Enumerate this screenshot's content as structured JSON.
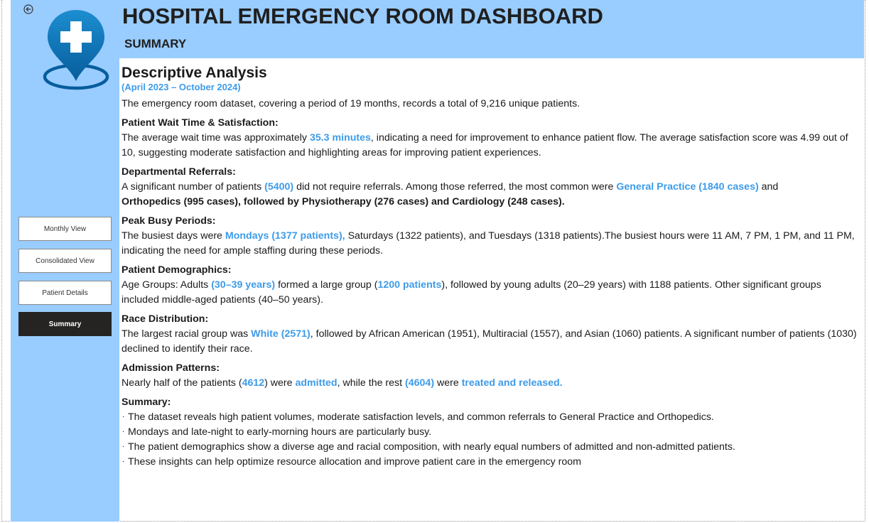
{
  "header": {
    "title": "HOSPITAL EMERGENCY ROOM DASHBOARD",
    "subtitle": "SUMMARY"
  },
  "nav": {
    "back_icon": "back-arrow-circle-icon",
    "logo_icon": "hospital-location-pin-icon",
    "items": [
      {
        "label": "Monthly View"
      },
      {
        "label": "Consolidated View"
      },
      {
        "label": "Patient Details"
      },
      {
        "label": "Summary",
        "active": true
      }
    ]
  },
  "colors": {
    "panel": "#99ccff",
    "highlight": "#3d9be9",
    "active_button": "#252423",
    "logo": "#0a6fb0"
  },
  "analysis": {
    "title": "Descriptive Analysis",
    "date_range": "(April 2023 – October 2024)",
    "intro": "The emergency room dataset, covering a period of 19 months, records a total of 9,216 unique patients.",
    "wait": {
      "title": "Patient Wait Time & Satisfaction:",
      "t1": "The average wait time was approximately ",
      "h1": "35.3 minutes",
      "t2": ", indicating a need for improvement to enhance patient flow. The average satisfaction score was 4.99 out of 10, suggesting moderate satisfaction and highlighting areas for improving patient experiences."
    },
    "referrals": {
      "title": "Departmental Referrals:",
      "t1": "A significant number of patients ",
      "h1": "(5400)",
      "t2": " did not require referrals. Among those referred, the most common were ",
      "h2": "General Practice (1840 cases)",
      "t3": " and ",
      "b1": "Orthopedics (995 cases), followed by Physiotherapy (276 cases) and Cardiology (248 cases)."
    },
    "peak": {
      "title": "Peak Busy Periods:",
      "t1": "The busiest days were ",
      "h1": "Mondays (1377 patients),",
      "t2": " Saturdays (1322 patients), and Tuesdays (1318 patients).The busiest hours were 11 AM, 7 PM, 1 PM, and 11 PM, indicating the need for ample staffing during these periods."
    },
    "demographics": {
      "title": "Patient Demographics:",
      "t1": "Age Groups: Adults ",
      "h1": "(30–39 years)",
      "t2": " formed a large group (",
      "h2": "1200 patients",
      "t3": "), followed by young adults (20–29 years) with 1188 patients. Other significant groups included middle-aged patients (40–50 years)."
    },
    "race": {
      "title": "Race Distribution:",
      "t1": "The largest racial group was ",
      "h1": "White (2571)",
      "t2": ", followed by African American (1951), Multiracial (1557), and Asian (1060) patients. A significant number of patients (1030) declined to identify their race."
    },
    "admission": {
      "title": "Admission Patterns:",
      "t1": "Nearly half of the patients (",
      "h1": "4612",
      "t2": ") were ",
      "h2": "admitted",
      "t3": ", while the rest ",
      "h3": "(4604)",
      "t4": " were ",
      "h4": "treated and released."
    },
    "summary": {
      "title": "Summary:",
      "bullets": [
        "The dataset reveals high patient volumes, moderate satisfaction levels, and common referrals to General Practice and Orthopedics.",
        "Mondays and late-night to early-morning hours are particularly busy.",
        "The patient demographics show a diverse age and racial composition, with nearly equal numbers of admitted and non-admitted patients.",
        "These insights can help optimize resource allocation and improve patient care in the emergency room"
      ]
    }
  }
}
